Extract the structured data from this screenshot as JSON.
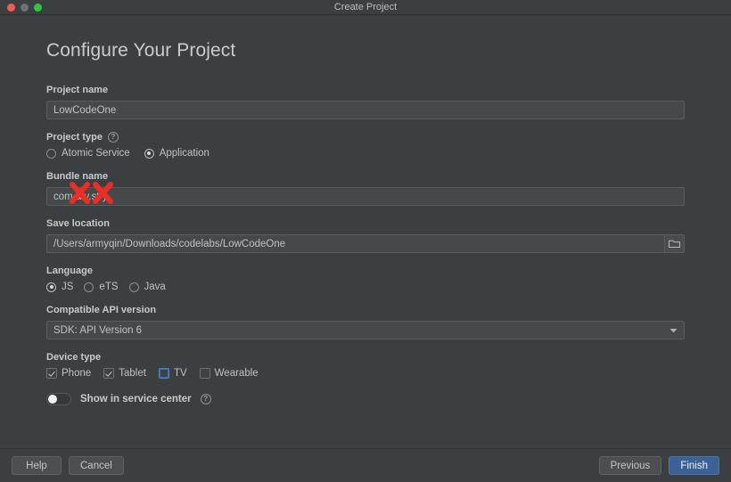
{
  "window": {
    "title": "Create Project",
    "traffic_lights": [
      "close-button",
      "minimize-button",
      "zoom-button"
    ]
  },
  "page": {
    "heading": "Configure Your Project"
  },
  "project_name": {
    "label": "Project name",
    "value": "LowCodeOne",
    "placeholder": "Project name"
  },
  "project_type": {
    "label": "Project type",
    "help": "?",
    "options": [
      {
        "label": "Atomic Service",
        "selected": false
      },
      {
        "label": "Application",
        "selected": true
      }
    ]
  },
  "bundle_name": {
    "label": "Bundle name",
    "value": "com.a    y.st   y",
    "placeholder": "Bundle name",
    "redacted": true,
    "redaction_color": "#ee2b24"
  },
  "save_location": {
    "label": "Save location",
    "value": "/Users/armyqin/Downloads/codelabs/LowCodeOne",
    "placeholder": "Save location",
    "browse_icon": "folder-icon"
  },
  "language": {
    "label": "Language",
    "options": [
      {
        "label": "JS",
        "selected": true
      },
      {
        "label": "eTS",
        "selected": false
      },
      {
        "label": "Java",
        "selected": false
      }
    ]
  },
  "api_version": {
    "label": "Compatible API version",
    "value": "SDK: API Version 6",
    "chevron": "chevron-down-icon"
  },
  "device_type": {
    "label": "Device type",
    "options": [
      {
        "label": "Phone",
        "checked": true,
        "focused": false
      },
      {
        "label": "Tablet",
        "checked": true,
        "focused": false
      },
      {
        "label": "TV",
        "checked": false,
        "focused": true
      },
      {
        "label": "Wearable",
        "checked": false,
        "focused": false
      }
    ]
  },
  "service_center": {
    "label": "Show in service center",
    "help": "?",
    "enabled": false
  },
  "footer": {
    "help_label": "Help",
    "cancel_label": "Cancel",
    "previous_label": "Previous",
    "finish_label": "Finish",
    "primary_color": "#3c6197"
  }
}
